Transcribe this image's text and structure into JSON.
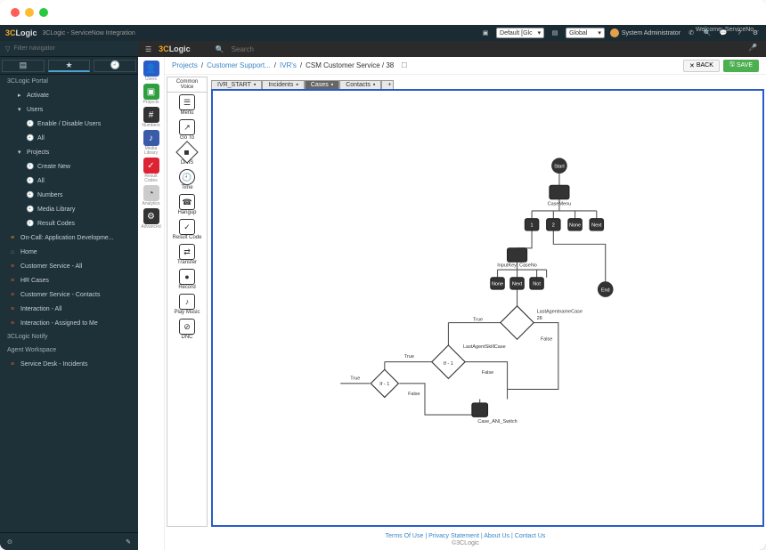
{
  "app_title": "3CLogic - ServiceNow Integration",
  "logo": {
    "prefix": "3C",
    "suffix": "Logic"
  },
  "topbar": {
    "scope1": "Default [Glc",
    "scope2": "Global",
    "user": "System Administrator"
  },
  "welcome": "Welcome: ServiceNo...",
  "filter_placeholder": "Filter navigator",
  "search_placeholder": "Search",
  "nav": {
    "section": "3CLogic Portal",
    "items": [
      {
        "label": "Activate",
        "caret": true
      },
      {
        "label": "Users",
        "caret": true,
        "expanded": true,
        "children": [
          {
            "label": "Enable / Disable Users",
            "icon": "clock"
          },
          {
            "label": "All",
            "icon": "clock"
          }
        ]
      },
      {
        "label": "Projects",
        "caret": true,
        "expanded": true,
        "children": [
          {
            "label": "Create New",
            "icon": "clock"
          },
          {
            "label": "All",
            "icon": "clock"
          },
          {
            "label": "Numbers",
            "icon": "clock"
          },
          {
            "label": "Media Library",
            "icon": "clock"
          },
          {
            "label": "Result Codes",
            "icon": "clock"
          }
        ]
      },
      {
        "label": "On-Call: Application Developme...",
        "flag": "bar"
      },
      {
        "label": "Home",
        "flag": "home"
      },
      {
        "label": "Customer Service - All",
        "flag": "list"
      },
      {
        "label": "HR Cases",
        "flag": "list"
      },
      {
        "label": "Customer Service - Contacts",
        "flag": "list"
      },
      {
        "label": "Interaction - All",
        "flag": "list"
      },
      {
        "label": "Interaction - Assigned to Me",
        "flag": "list"
      }
    ],
    "section2": "3CLogic Notify",
    "section3": "Agent Workspace",
    "last": "Service Desk - Incidents"
  },
  "rail": [
    {
      "label": "Users",
      "color": "#2a5cc7",
      "glyph": "👤"
    },
    {
      "label": "Projects",
      "color": "#2e9e3f",
      "glyph": "▣"
    },
    {
      "label": "Numbers",
      "color": "#333",
      "glyph": "#"
    },
    {
      "label": "Media Library",
      "color": "#3a5ba8",
      "glyph": "♪"
    },
    {
      "label": "Result Codes",
      "color": "#d23",
      "glyph": "✓"
    },
    {
      "label": "Analytics",
      "color": "#bbb",
      "glyph": "◔"
    },
    {
      "label": "Advanced",
      "color": "#333",
      "glyph": "⚙"
    }
  ],
  "breadcrumb": {
    "p0": "Projects",
    "p1": "Customer Support...",
    "p2": "IVR's",
    "cur": "CSM Customer Service / 38"
  },
  "buttons": {
    "back": "BACK",
    "save": "SAVE"
  },
  "palette": {
    "header1": "Common",
    "header2": "Voice",
    "items": [
      "Menu",
      "Go To",
      "DNIS",
      "Time",
      "Hangup",
      "Result Code",
      "Transfer",
      "Record",
      "Play Music",
      "DNC"
    ]
  },
  "tabs": [
    {
      "label": "IVR_START",
      "active": false
    },
    {
      "label": "Incidents",
      "active": false
    },
    {
      "label": "Cases",
      "active": true
    },
    {
      "label": "Contacts",
      "active": false
    }
  ],
  "flow": {
    "start": "Start",
    "casemenu": "CaseMenu",
    "keys": [
      "1",
      "2",
      "None",
      "Next"
    ],
    "inputkey": "InputKey: CaseNo",
    "ikrow": [
      "None",
      "Next",
      "Not"
    ],
    "end": "End",
    "d1": "LastAgentnameCase",
    "d1sub": "28",
    "d2": "LastAgentSkillCase",
    "d2sub": "If - 1",
    "d2b": "If - 1",
    "d3": "Case_ANI_Switch",
    "true": "True",
    "false": "False"
  },
  "footer": {
    "links": [
      "Terms Of Use",
      "Privacy Statement",
      "About Us",
      "Contact Us"
    ],
    "copy": "©3CLogic"
  }
}
